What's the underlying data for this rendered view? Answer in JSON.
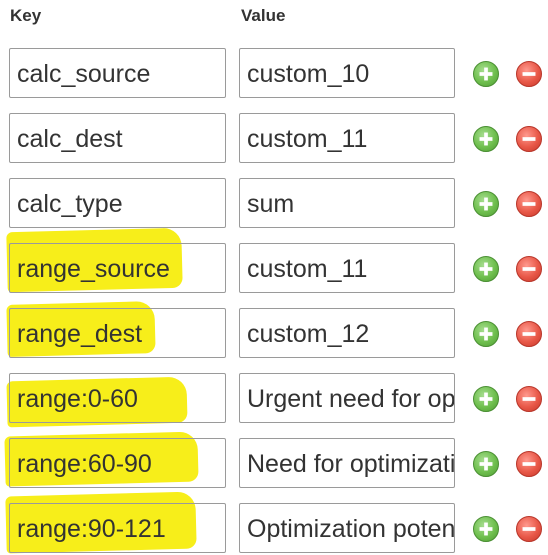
{
  "header": {
    "key_label": "Key",
    "value_label": "Value"
  },
  "colors": {
    "highlight": "#f7ee1a",
    "add_button": "#6fbf4e",
    "remove_button": "#e85848"
  },
  "icons": {
    "add": "plus-circle-icon",
    "remove": "minus-circle-icon"
  },
  "rows": [
    {
      "key": "calc_source",
      "value": "custom_10",
      "key_highlighted": false
    },
    {
      "key": "calc_dest",
      "value": "custom_11",
      "key_highlighted": false
    },
    {
      "key": "calc_type",
      "value": "sum",
      "key_highlighted": false
    },
    {
      "key": "range_source",
      "value": "custom_11",
      "key_highlighted": true
    },
    {
      "key": "range_dest",
      "value": "custom_12",
      "key_highlighted": true
    },
    {
      "key": "range:0-60",
      "value": "Urgent need for optimization",
      "key_highlighted": true
    },
    {
      "key": "range:60-90",
      "value": "Need for optimization",
      "key_highlighted": true
    },
    {
      "key": "range:90-121",
      "value": "Optimization potential",
      "key_highlighted": true
    }
  ]
}
